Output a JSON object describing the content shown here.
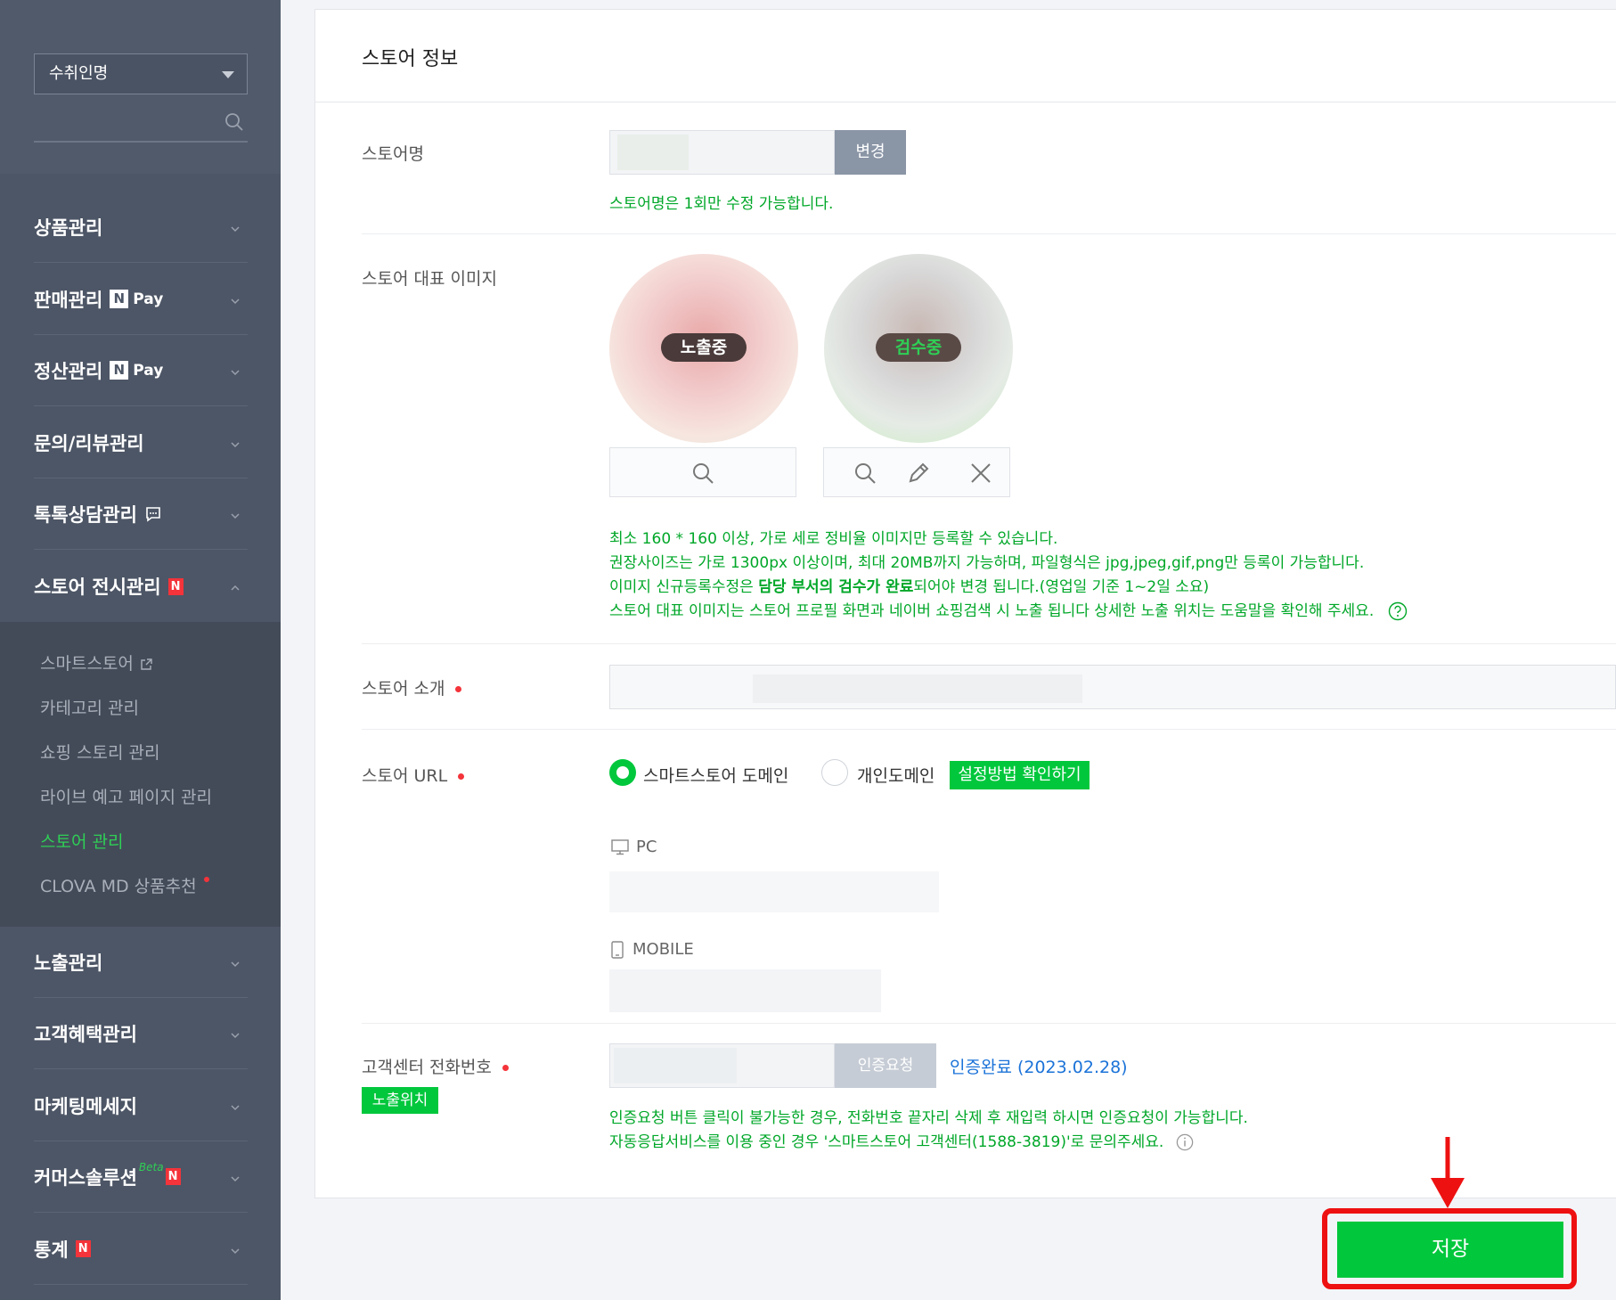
{
  "sidebar": {
    "account_select": "수취인명",
    "menu": [
      {
        "label": "상품관리"
      },
      {
        "label": "판매관리",
        "pay": "Pay",
        "n": "N"
      },
      {
        "label": "정산관리",
        "pay": "Pay",
        "n": "N"
      },
      {
        "label": "문의/리뷰관리"
      },
      {
        "label": "톡톡상담관리"
      },
      {
        "label": "스토어 전시관리",
        "badge": "N"
      },
      {
        "label": "노출관리"
      },
      {
        "label": "고객혜택관리"
      },
      {
        "label": "마케팅메세지"
      },
      {
        "label": "커머스솔루션",
        "beta": "Beta",
        "badge": "N"
      },
      {
        "label": "통계",
        "badge": "N"
      }
    ],
    "submenu": [
      {
        "label": "스마트스토어"
      },
      {
        "label": "카테고리 관리"
      },
      {
        "label": "쇼핑 스토리 관리"
      },
      {
        "label": "라이브 예고 페이지 관리"
      },
      {
        "label": "스토어 관리"
      },
      {
        "label": "CLOVA MD 상품추천"
      }
    ]
  },
  "panel": {
    "title": "스토어 정보",
    "store_name": {
      "label": "스토어명",
      "change_button": "변경",
      "note": "스토어명은 1회만 수정 가능합니다."
    },
    "store_image": {
      "label": "스토어 대표 이미지",
      "badge_live": "노출중",
      "badge_review": "검수중",
      "notes": [
        "최소 160 * 160 이상, 가로 세로 정비율 이미지만 등록할 수 있습니다.",
        "권장사이즈는 가로 1300px 이상이며, 최대 20MB까지 가능하며, 파일형식은 jpg,jpeg,gif,png만 등록이 가능합니다.",
        "이미지 신규등록수정은 ",
        "담당 부서의 검수가 완료",
        "되어야 변경 됩니다.(영업일 기준 1~2일 소요)",
        "스토어 대표 이미지는 스토어 프로필 화면과 네이버 쇼핑검색 시 노출 됩니다 상세한 노출 위치는 도움말을 확인해 주세요."
      ]
    },
    "store_intro": {
      "label": "스토어 소개"
    },
    "store_url": {
      "label": "스토어 URL",
      "option_smart": "스마트스토어 도메인",
      "option_personal": "개인도메인",
      "guide_button": "설정방법 확인하기",
      "pc_label": "PC",
      "mobile_label": "MOBILE"
    },
    "phone": {
      "label": "고객센터 전화번호",
      "position_badge": "노출위치",
      "verify_button": "인증요청",
      "verified_text": "인증완료 (2023.02.28)",
      "notes": [
        "인증요청 버튼 클릭이 불가능한 경우, 전화번호 끝자리 삭제 후 재입력 하시면 인증요청이 가능합니다.",
        "자동응답서비스를 이용 중인 경우 '스마트스토어 고객센터(1588-3819)'로 문의주세요."
      ]
    }
  },
  "actions": {
    "save": "저장"
  },
  "colors": {
    "accent": "#00c73c",
    "sidebar": "#4d5666",
    "highlight": "#ee1111"
  }
}
